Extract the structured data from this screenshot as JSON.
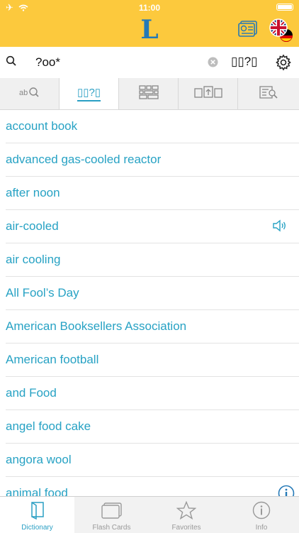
{
  "status": {
    "time": "11:00"
  },
  "header": {
    "logo": "L"
  },
  "search": {
    "query": "?oo*",
    "mode_label": "▯▯?▯"
  },
  "tabs": [
    {
      "name": "tab-headword",
      "label": "ab"
    },
    {
      "name": "tab-wildcard",
      "label": "▯▯?▯"
    },
    {
      "name": "tab-grid",
      "label": ""
    },
    {
      "name": "tab-compare",
      "label": ""
    },
    {
      "name": "tab-fulltext",
      "label": ""
    }
  ],
  "entries": [
    "account book",
    "advanced gas-cooled reactor",
    "after noon",
    "air-cooled",
    "air cooling",
    "All Fool’s Day",
    "American Booksellers Association",
    "American football",
    "and Food",
    "angel food cake",
    "angora wool",
    "animal food"
  ],
  "tabbar": [
    {
      "label": "Dictionary"
    },
    {
      "label": "Flash Cards"
    },
    {
      "label": "Favorites"
    },
    {
      "label": "Info"
    }
  ]
}
